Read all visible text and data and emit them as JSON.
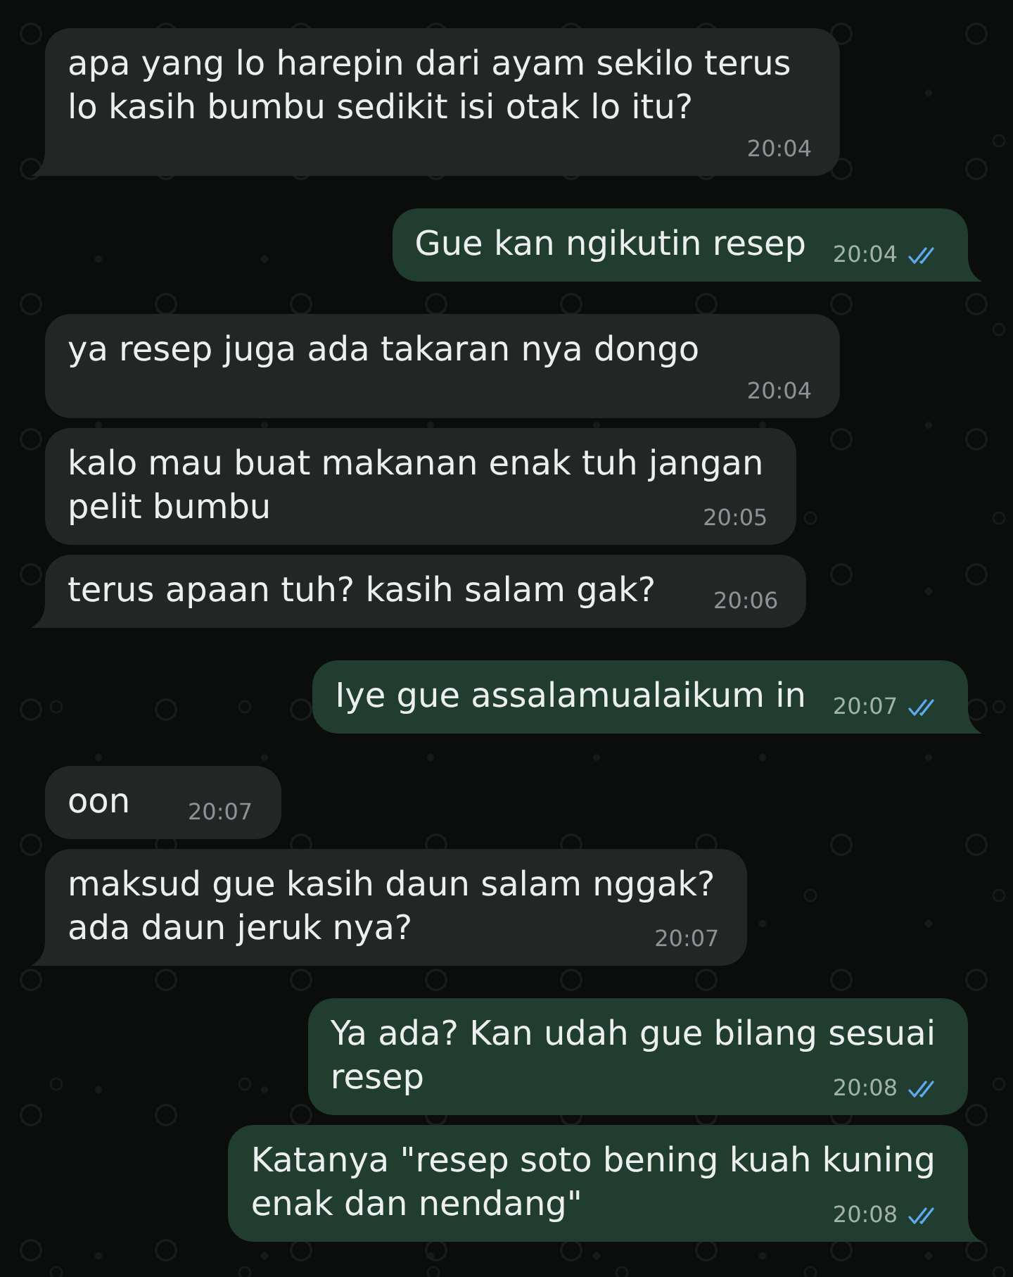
{
  "messages": [
    {
      "kind": "received",
      "lines": [
        "apa yang lo harepin dari ayam sekilo terus",
        "lo kasih bumbu sedikit isi otak lo itu?"
      ],
      "time": "20:04"
    },
    {
      "kind": "sent",
      "lines": [
        "Gue kan ngikutin resep"
      ],
      "time": "20:04",
      "read": true
    },
    {
      "kind": "received",
      "lines": [
        "ya resep juga ada takaran nya dongo"
      ],
      "time": "20:04"
    },
    {
      "kind": "received",
      "lines": [
        "kalo mau buat makanan enak tuh jangan",
        "pelit bumbu"
      ],
      "time": "20:05"
    },
    {
      "kind": "received",
      "lines": [
        "terus apaan tuh? kasih salam gak?"
      ],
      "time": "20:06"
    },
    {
      "kind": "sent",
      "lines": [
        "Iye gue assalamualaikum in"
      ],
      "time": "20:07",
      "read": true
    },
    {
      "kind": "received",
      "lines": [
        "oon"
      ],
      "time": "20:07"
    },
    {
      "kind": "received",
      "lines": [
        "maksud gue kasih daun salam nggak?",
        "ada daun jeruk nya?"
      ],
      "time": "20:07"
    },
    {
      "kind": "sent",
      "lines": [
        "Ya ada? Kan udah gue bilang sesuai",
        "resep"
      ],
      "time": "20:08",
      "read": true
    },
    {
      "kind": "sent",
      "lines": [
        "Katanya \"resep soto bening kuah kuning",
        "enak dan nendang\""
      ],
      "time": "20:08",
      "read": true
    }
  ]
}
